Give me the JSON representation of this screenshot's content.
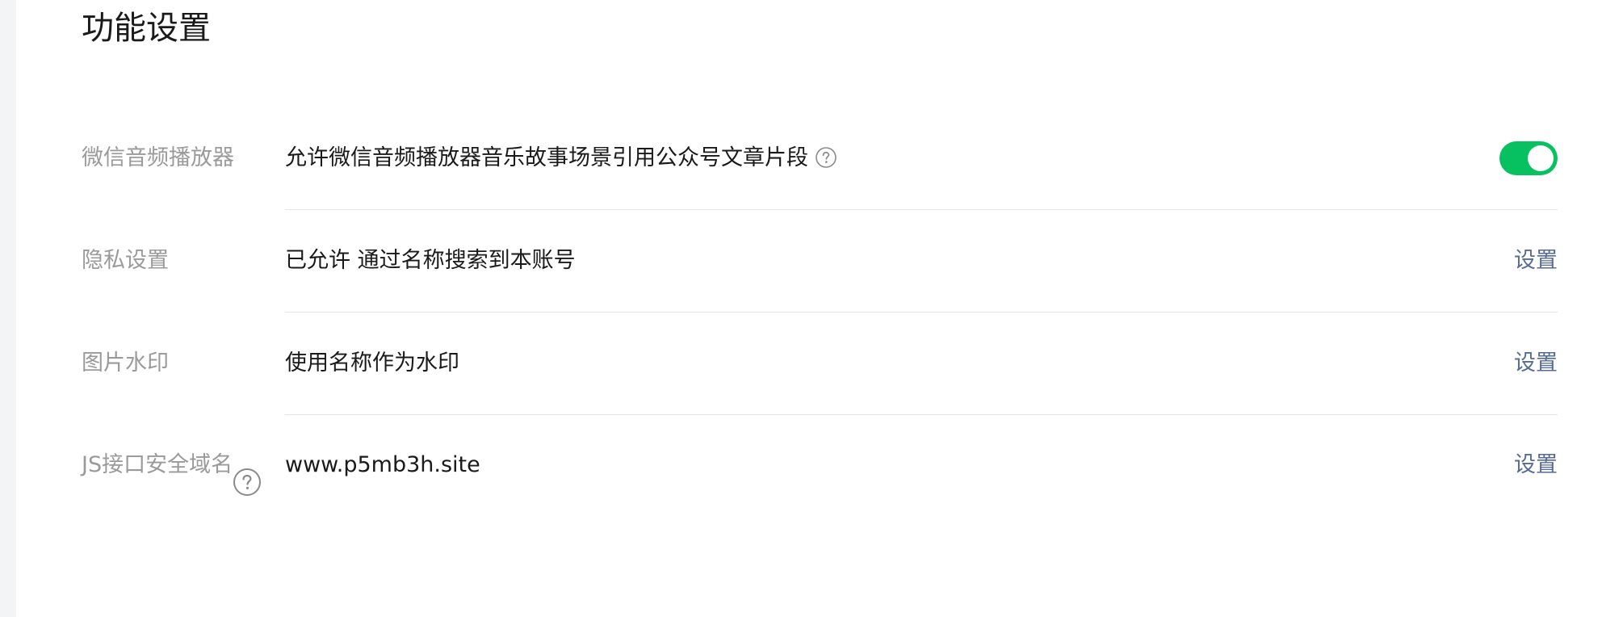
{
  "section": {
    "title": "功能设置"
  },
  "rows": [
    {
      "label": "微信音频播放器",
      "value": "允许微信音频播放器音乐故事场景引用公众号文章片段",
      "control": "toggle",
      "toggle_on": true
    },
    {
      "label": "隐私设置",
      "value": "已允许 通过名称搜索到本账号",
      "action_label": "设置"
    },
    {
      "label": "图片水印",
      "value": "使用名称作为水印",
      "action_label": "设置"
    },
    {
      "label": "JS接口安全域名",
      "value": "www.p5mb3h.site",
      "action_label": "设置"
    }
  ],
  "icons": {
    "help": "question-circle-icon"
  },
  "colors": {
    "toggle_on": "#07c160",
    "link": "#576b95",
    "label": "#9a9a9a",
    "text": "#1a1a1a",
    "divider": "#e5e5e5"
  }
}
